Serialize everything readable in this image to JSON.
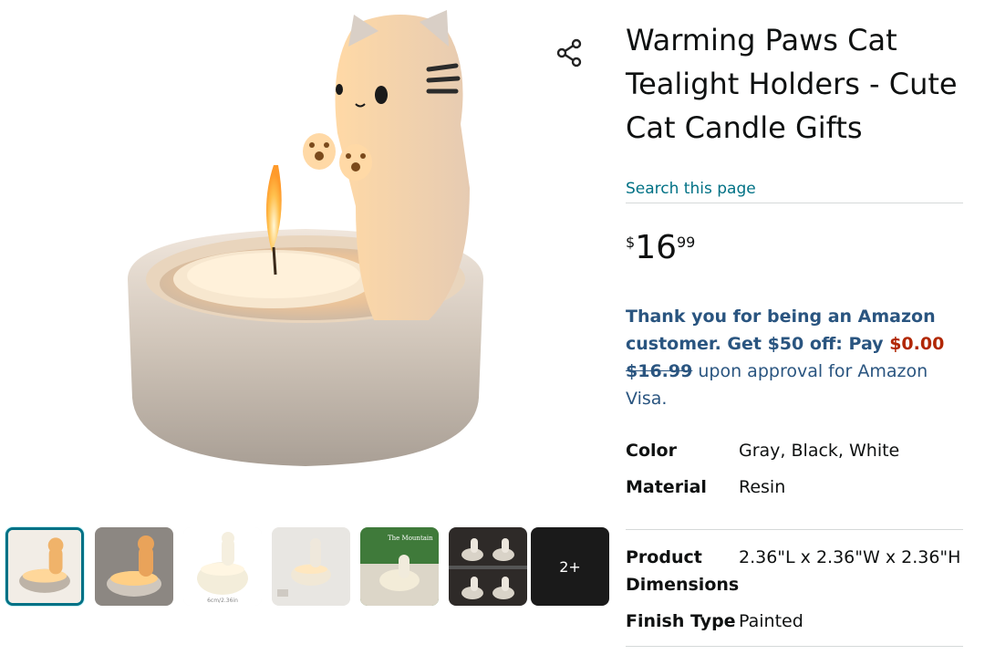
{
  "product": {
    "title": "Warming Paws Cat Tealight Holders - Cute Cat Candle Gifts",
    "search_link": "Search this page",
    "price": {
      "symbol": "$",
      "whole": "16",
      "fraction": "99"
    }
  },
  "promo": {
    "line1": "Thank you for being an Amazon customer. Get $50 off: Pay ",
    "pay_amount": "$0.00",
    "strike_price": "$16.99",
    "line_end": " upon approval for Amazon Visa."
  },
  "specs": [
    {
      "label": "Color",
      "value": "Gray, Black, White"
    },
    {
      "label": "Material",
      "value": "Resin"
    },
    {
      "label": "Product Dimensions",
      "value": "2.36\"L x 2.36\"W x 2.36\"H"
    },
    {
      "label": "Finish Type",
      "value": "Painted"
    }
  ],
  "thumbnails": {
    "more_label": "2+",
    "thumb3_caption": "6cm/2.36in",
    "thumb5_caption": "The Mountain"
  },
  "colors": {
    "link": "#007185",
    "promo_text": "#2a5580",
    "deal_red": "#b12704",
    "selected_border": "#007185"
  },
  "icons": {
    "share": "share-icon"
  }
}
